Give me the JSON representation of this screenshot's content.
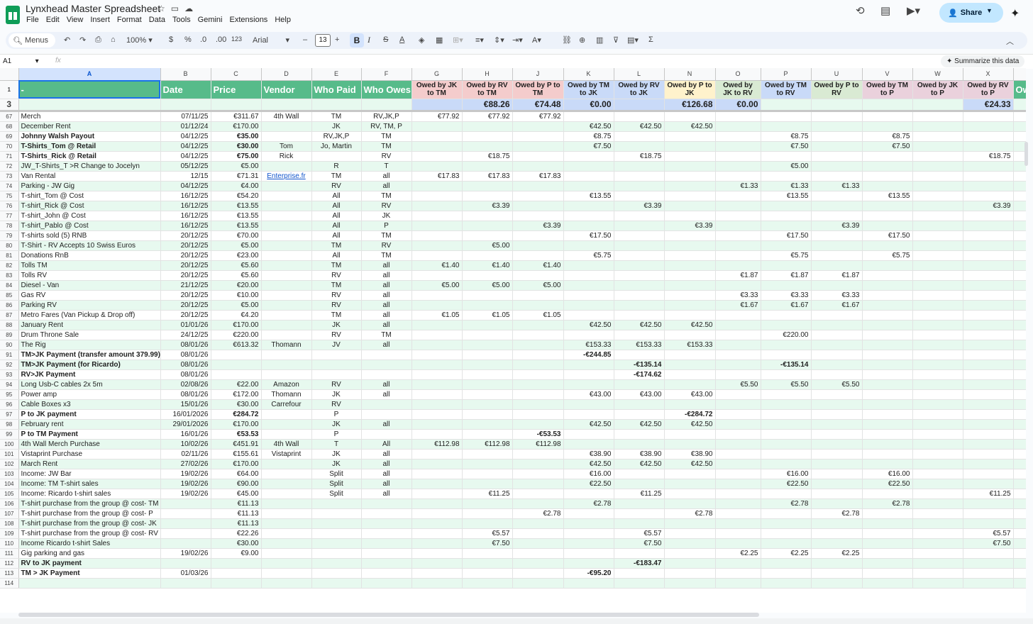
{
  "app": {
    "title": "Lynxhead Master Spreadsheet",
    "menu": [
      "File",
      "Edit",
      "View",
      "Insert",
      "Format",
      "Data",
      "Tools",
      "Gemini",
      "Extensions",
      "Help"
    ],
    "share_label": "Share"
  },
  "toolbar": {
    "menus": "Menus",
    "zoom": "100%",
    "currency": "$",
    "percent": "%",
    "dec_less": ".0",
    "dec_more": ".00",
    "number_format": "123",
    "font": "Arial",
    "font_size": "13",
    "bold": "B",
    "italic": "I"
  },
  "formula": {
    "cell_ref": "A1",
    "fx": "fx",
    "summarize": "Summarize this data"
  },
  "colors": {
    "header_green": "#57bb8a",
    "pink": "#f4cccc",
    "blue": "#c9daf8",
    "yellow": "#fff2cc",
    "green_light": "#d9ead3",
    "purple": "#ead1dc",
    "band": "#e7f9ef",
    "link": "#1155cc"
  },
  "columns": [
    "A",
    "B",
    "C",
    "D",
    "E",
    "F",
    "G",
    "H",
    "J",
    "K",
    "L",
    "N",
    "O",
    "P",
    "U",
    "V",
    "W",
    "X",
    ""
  ],
  "header_row": {
    "num": "1",
    "cells": [
      "-",
      "Date",
      "Price",
      "Vendor",
      "Who Paid",
      "Who Owes",
      "Owed by JK to TM",
      "Owed by RV to TM",
      "Owed by P to TM",
      "Owed by TM to JK",
      "Owed by RV to JK",
      "Owed by P to JK",
      "Owed by JK to RV",
      "Owed by TM to RV",
      "Owed by P to RV",
      "Owed by TM to P",
      "Owed by JK to P",
      "Owed by RV to P",
      "Ow"
    ]
  },
  "totals_row": {
    "num": "3",
    "cells": [
      "",
      "",
      "",
      "",
      "",
      "",
      "",
      "€88.26",
      "€74.48",
      "€0.00",
      "",
      "€126.68",
      "€0.00",
      "",
      "",
      "",
      "",
      "€24.33",
      ""
    ]
  },
  "rows": [
    {
      "n": "67",
      "c": [
        "Merch",
        "07/11/25",
        "€311.67",
        "4th Wall",
        "TM",
        "RV,JK,P",
        "€77.92",
        "€77.92",
        "€77.92",
        "",
        "",
        "",
        "",
        "",
        "",
        "",
        "",
        "",
        ""
      ]
    },
    {
      "n": "68",
      "c": [
        "December Rent",
        "01/12/24",
        "€170.00",
        "",
        "JK",
        "RV, TM, P",
        "",
        "",
        "",
        "€42.50",
        "€42.50",
        "€42.50",
        "",
        "",
        "",
        "",
        "",
        "",
        ""
      ]
    },
    {
      "n": "69",
      "c": [
        "Johnny Walsh Payout",
        "04/12/25",
        "€35.00",
        "",
        "RV,JK,P",
        "TM",
        "",
        "",
        "",
        "€8.75",
        "",
        "",
        "",
        "€8.75",
        "",
        "€8.75",
        "",
        "",
        ""
      ],
      "b": true
    },
    {
      "n": "70",
      "c": [
        "T-Shirts_Tom @ Retail",
        "04/12/25",
        "€30.00",
        "Tom",
        "Jo, Martin",
        "TM",
        "",
        "",
        "",
        "€7.50",
        "",
        "",
        "",
        "€7.50",
        "",
        "€7.50",
        "",
        "",
        ""
      ],
      "b": true
    },
    {
      "n": "71",
      "c": [
        "T-Shirts_Rick @ Retail",
        "04/12/25",
        "€75.00",
        "Rick",
        "",
        "RV",
        "",
        "€18.75",
        "",
        "",
        "€18.75",
        "",
        "",
        "",
        "",
        "",
        "",
        "€18.75",
        ""
      ],
      "b": true
    },
    {
      "n": "72",
      "c": [
        "JW_T-Shirts_T >R Change to Jocelyn",
        "05/12/25",
        "€5.00",
        "",
        "R",
        "T",
        "",
        "",
        "",
        "",
        "",
        "",
        "",
        "€5.00",
        "",
        "",
        "",
        "",
        ""
      ]
    },
    {
      "n": "73",
      "c": [
        "Van Rental",
        "12/15",
        "€71.31",
        "Enterprise.fr",
        "TM",
        "all",
        "€17.83",
        "€17.83",
        "€17.83",
        "",
        "",
        "",
        "",
        "",
        "",
        "",
        "",
        "",
        ""
      ],
      "link": true
    },
    {
      "n": "74",
      "c": [
        "Parking - JW Gig",
        "04/12/25",
        "€4.00",
        "",
        "RV",
        "all",
        "",
        "",
        "",
        "",
        "",
        "",
        "€1.33",
        "€1.33",
        "€1.33",
        "",
        "",
        "",
        ""
      ]
    },
    {
      "n": "75",
      "c": [
        "T-shirt_Tom @ Cost",
        "16/12/25",
        "€54.20",
        "",
        "All",
        "TM",
        "",
        "",
        "",
        "€13.55",
        "",
        "",
        "",
        "€13.55",
        "",
        "€13.55",
        "",
        "",
        ""
      ]
    },
    {
      "n": "76",
      "c": [
        "T-shirt_Rick @ Cost",
        "16/12/25",
        "€13.55",
        "",
        "All",
        "RV",
        "",
        "€3.39",
        "",
        "",
        "€3.39",
        "",
        "",
        "",
        "",
        "",
        "",
        "€3.39",
        ""
      ]
    },
    {
      "n": "77",
      "c": [
        "T-shirt_John @ Cost",
        "16/12/25",
        "€13.55",
        "",
        "All",
        "JK",
        "",
        "",
        "",
        "",
        "",
        "",
        "",
        "",
        "",
        "",
        "",
        "",
        ""
      ]
    },
    {
      "n": "78",
      "c": [
        "T-shirt_Pablo @ Cost",
        "16/12/25",
        "€13.55",
        "",
        "All",
        "P",
        "",
        "",
        "€3.39",
        "",
        "",
        "€3.39",
        "",
        "",
        "€3.39",
        "",
        "",
        "",
        ""
      ]
    },
    {
      "n": "79",
      "c": [
        "T-shirts sold (5) RNB",
        "20/12/25",
        "€70.00",
        "",
        "All",
        "TM",
        "",
        "",
        "",
        "€17.50",
        "",
        "",
        "",
        "€17.50",
        "",
        "€17.50",
        "",
        "",
        ""
      ]
    },
    {
      "n": "80",
      "c": [
        "T-Shirt - RV Accepts 10 Swiss Euros",
        "20/12/25",
        "€5.00",
        "",
        "TM",
        "RV",
        "",
        "€5.00",
        "",
        "",
        "",
        "",
        "",
        "",
        "",
        "",
        "",
        "",
        ""
      ]
    },
    {
      "n": "81",
      "c": [
        "Donations RnB",
        "20/12/25",
        "€23.00",
        "",
        "All",
        "TM",
        "",
        "",
        "",
        "€5.75",
        "",
        "",
        "",
        "€5.75",
        "",
        "€5.75",
        "",
        "",
        ""
      ]
    },
    {
      "n": "82",
      "c": [
        "Tolls TM",
        "20/12/25",
        "€5.60",
        "",
        "TM",
        "all",
        "€1.40",
        "€1.40",
        "€1.40",
        "",
        "",
        "",
        "",
        "",
        "",
        "",
        "",
        "",
        ""
      ]
    },
    {
      "n": "83",
      "c": [
        "Tolls RV",
        "20/12/25",
        "€5.60",
        "",
        "RV",
        "all",
        "",
        "",
        "",
        "",
        "",
        "",
        "€1.87",
        "€1.87",
        "€1.87",
        "",
        "",
        "",
        ""
      ]
    },
    {
      "n": "84",
      "c": [
        "Diesel - Van",
        "21/12/25",
        "€20.00",
        "",
        "TM",
        "all",
        "€5.00",
        "€5.00",
        "€5.00",
        "",
        "",
        "",
        "",
        "",
        "",
        "",
        "",
        "",
        ""
      ]
    },
    {
      "n": "85",
      "c": [
        "Gas RV",
        "20/12/25",
        "€10.00",
        "",
        "RV",
        "all",
        "",
        "",
        "",
        "",
        "",
        "",
        "€3.33",
        "€3.33",
        "€3.33",
        "",
        "",
        "",
        ""
      ]
    },
    {
      "n": "86",
      "c": [
        "Parking RV",
        "20/12/25",
        "€5.00",
        "",
        "RV",
        "all",
        "",
        "",
        "",
        "",
        "",
        "",
        "€1.67",
        "€1.67",
        "€1.67",
        "",
        "",
        "",
        ""
      ]
    },
    {
      "n": "87",
      "c": [
        "Metro Fares (Van Pickup & Drop off)",
        "20/12/25",
        "€4.20",
        "",
        "TM",
        "all",
        "€1.05",
        "€1.05",
        "€1.05",
        "",
        "",
        "",
        "",
        "",
        "",
        "",
        "",
        "",
        ""
      ]
    },
    {
      "n": "88",
      "c": [
        "January Rent",
        "01/01/26",
        "€170.00",
        "",
        "JK",
        "all",
        "",
        "",
        "",
        "€42.50",
        "€42.50",
        "€42.50",
        "",
        "",
        "",
        "",
        "",
        "",
        ""
      ]
    },
    {
      "n": "89",
      "c": [
        "Drum Throne Sale",
        "24/12/25",
        "€220.00",
        "",
        "RV",
        "TM",
        "",
        "",
        "",
        "",
        "",
        "",
        "",
        "€220.00",
        "",
        "",
        "",
        "",
        ""
      ]
    },
    {
      "n": "90",
      "c": [
        "The Rig",
        "08/01/26",
        "€613.32",
        "Thomann",
        "JV",
        "all",
        "",
        "",
        "",
        "€153.33",
        "€153.33",
        "€153.33",
        "",
        "",
        "",
        "",
        "",
        "",
        ""
      ]
    },
    {
      "n": "91",
      "c": [
        "TM>JK Payment (transfer amount 379.99)",
        "08/01/26",
        "",
        "",
        "",
        "",
        "",
        "",
        "",
        "-€244.85",
        "",
        "",
        "",
        "",
        "",
        "",
        "",
        "",
        ""
      ],
      "b": true
    },
    {
      "n": "92",
      "c": [
        "TM>JK Payment (for Ricardo)",
        "08/01/26",
        "",
        "",
        "",
        "",
        "",
        "",
        "",
        "",
        "-€135.14",
        "",
        "",
        "-€135.14",
        "",
        "",
        "",
        "",
        ""
      ],
      "b": true
    },
    {
      "n": "93",
      "c": [
        "RV>JK Payment",
        "08/01/26",
        "",
        "",
        "",
        "",
        "",
        "",
        "",
        "",
        "-€174.62",
        "",
        "",
        "",
        "",
        "",
        "",
        "",
        ""
      ],
      "b": true
    },
    {
      "n": "94",
      "c": [
        "Long Usb-C cables 2x 5m",
        "02/08/26",
        "€22.00",
        "Amazon",
        "RV",
        "all",
        "",
        "",
        "",
        "",
        "",
        "",
        "€5.50",
        "€5.50",
        "€5.50",
        "",
        "",
        "",
        ""
      ]
    },
    {
      "n": "95",
      "c": [
        "Power amp",
        "08/01/26",
        "€172.00",
        "Thomann",
        "JK",
        "all",
        "",
        "",
        "",
        "€43.00",
        "€43.00",
        "€43.00",
        "",
        "",
        "",
        "",
        "",
        "",
        ""
      ]
    },
    {
      "n": "96",
      "c": [
        "Cable Boxes x3",
        "15/01/26",
        "€30.00",
        "Carrefour",
        "RV",
        "",
        "",
        "",
        "",
        "",
        "",
        "",
        "",
        "",
        "",
        "",
        "",
        "",
        ""
      ]
    },
    {
      "n": "97",
      "c": [
        "P to JK payment",
        "16/01/2026",
        "€284.72",
        "",
        "P",
        "",
        "",
        "",
        "",
        "",
        "",
        "-€284.72",
        "",
        "",
        "",
        "",
        "",
        "",
        ""
      ],
      "b": true
    },
    {
      "n": "98",
      "c": [
        "February rent",
        "29/01/2026",
        "€170.00",
        "",
        "JK",
        "all",
        "",
        "",
        "",
        "€42.50",
        "€42.50",
        "€42.50",
        "",
        "",
        "",
        "",
        "",
        "",
        ""
      ]
    },
    {
      "n": "99",
      "c": [
        "P to TM Payment",
        "16/01/26",
        "€53.53",
        "",
        "P",
        "",
        "",
        "",
        "-€53.53",
        "",
        "",
        "",
        "",
        "",
        "",
        "",
        "",
        "",
        ""
      ],
      "b": true
    },
    {
      "n": "100",
      "c": [
        "4th Wall Merch Purchase",
        "10/02/26",
        "€451.91",
        "4th Wall",
        "T",
        "All",
        "€112.98",
        "€112.98",
        "€112.98",
        "",
        "",
        "",
        "",
        "",
        "",
        "",
        "",
        "",
        ""
      ]
    },
    {
      "n": "101",
      "c": [
        "Vistaprint Purchase",
        "02/11/26",
        "€155.61",
        "Vistaprint",
        "JK",
        "all",
        "",
        "",
        "",
        "€38.90",
        "€38.90",
        "€38.90",
        "",
        "",
        "",
        "",
        "",
        "",
        ""
      ]
    },
    {
      "n": "102",
      "c": [
        "March Rent",
        "27/02/26",
        "€170.00",
        "",
        "JK",
        "all",
        "",
        "",
        "",
        "€42.50",
        "€42.50",
        "€42.50",
        "",
        "",
        "",
        "",
        "",
        "",
        ""
      ]
    },
    {
      "n": "103",
      "c": [
        "Income: JW Bar",
        "19/02/26",
        "€64.00",
        "",
        "Split",
        "all",
        "",
        "",
        "",
        "€16.00",
        "",
        "",
        "",
        "€16.00",
        "",
        "€16.00",
        "",
        "",
        ""
      ]
    },
    {
      "n": "104",
      "c": [
        "Income: TM T-shirt sales",
        "19/02/26",
        "€90.00",
        "",
        "Split",
        "all",
        "",
        "",
        "",
        "€22.50",
        "",
        "",
        "",
        "€22.50",
        "",
        "€22.50",
        "",
        "",
        ""
      ]
    },
    {
      "n": "105",
      "c": [
        "Income: Ricardo t-shirt sales",
        "19/02/26",
        "€45.00",
        "",
        "Split",
        "all",
        "",
        "€11.25",
        "",
        "",
        "€11.25",
        "",
        "",
        "",
        "",
        "",
        "",
        "€11.25",
        ""
      ]
    },
    {
      "n": "106",
      "c": [
        "T-shirt purchase from the group @ cost- TM",
        "",
        "€11.13",
        "",
        "",
        "",
        "",
        "",
        "",
        "€2.78",
        "",
        "",
        "",
        "€2.78",
        "",
        "€2.78",
        "",
        "",
        ""
      ]
    },
    {
      "n": "107",
      "c": [
        "T-shirt purchase from the group @ cost- P",
        "",
        "€11.13",
        "",
        "",
        "",
        "",
        "",
        "€2.78",
        "",
        "",
        "€2.78",
        "",
        "",
        "€2.78",
        "",
        "",
        "",
        ""
      ]
    },
    {
      "n": "108",
      "c": [
        "T-shirt purchase from the group @ cost- JK",
        "",
        "€11.13",
        "",
        "",
        "",
        "",
        "",
        "",
        "",
        "",
        "",
        "",
        "",
        "",
        "",
        "",
        "",
        ""
      ]
    },
    {
      "n": "109",
      "c": [
        "T-shirt purchase from the group @ cost- RV",
        "",
        "€22.26",
        "",
        "",
        "",
        "",
        "€5.57",
        "",
        "",
        "€5.57",
        "",
        "",
        "",
        "",
        "",
        "",
        "€5.57",
        ""
      ]
    },
    {
      "n": "110",
      "c": [
        "Income Ricardo t-shirt Sales",
        "",
        "€30.00",
        "",
        "",
        "",
        "",
        "€7.50",
        "",
        "",
        "€7.50",
        "",
        "",
        "",
        "",
        "",
        "",
        "€7.50",
        ""
      ]
    },
    {
      "n": "111",
      "c": [
        "Gig parking and gas",
        "19/02/26",
        "€9.00",
        "",
        "",
        "",
        "",
        "",
        "",
        "",
        "",
        "",
        "€2.25",
        "€2.25",
        "€2.25",
        "",
        "",
        "",
        ""
      ]
    },
    {
      "n": "112",
      "c": [
        "RV to JK payment",
        "",
        "",
        "",
        "",
        "",
        "",
        "",
        "",
        "",
        "-€183.47",
        "",
        "",
        "",
        "",
        "",
        "",
        "",
        ""
      ],
      "b": true
    },
    {
      "n": "113",
      "c": [
        "TM > JK Payment",
        "01/03/26",
        "",
        "",
        "",
        "",
        "",
        "",
        "",
        "-€95.20",
        "",
        "",
        "",
        "",
        "",
        "",
        "",
        "",
        ""
      ],
      "b": true
    },
    {
      "n": "114",
      "c": [
        "",
        "",
        "",
        "",
        "",
        "",
        "",
        "",
        "",
        "",
        "",
        "",
        "",
        "",
        "",
        "",
        "",
        "",
        ""
      ]
    }
  ]
}
